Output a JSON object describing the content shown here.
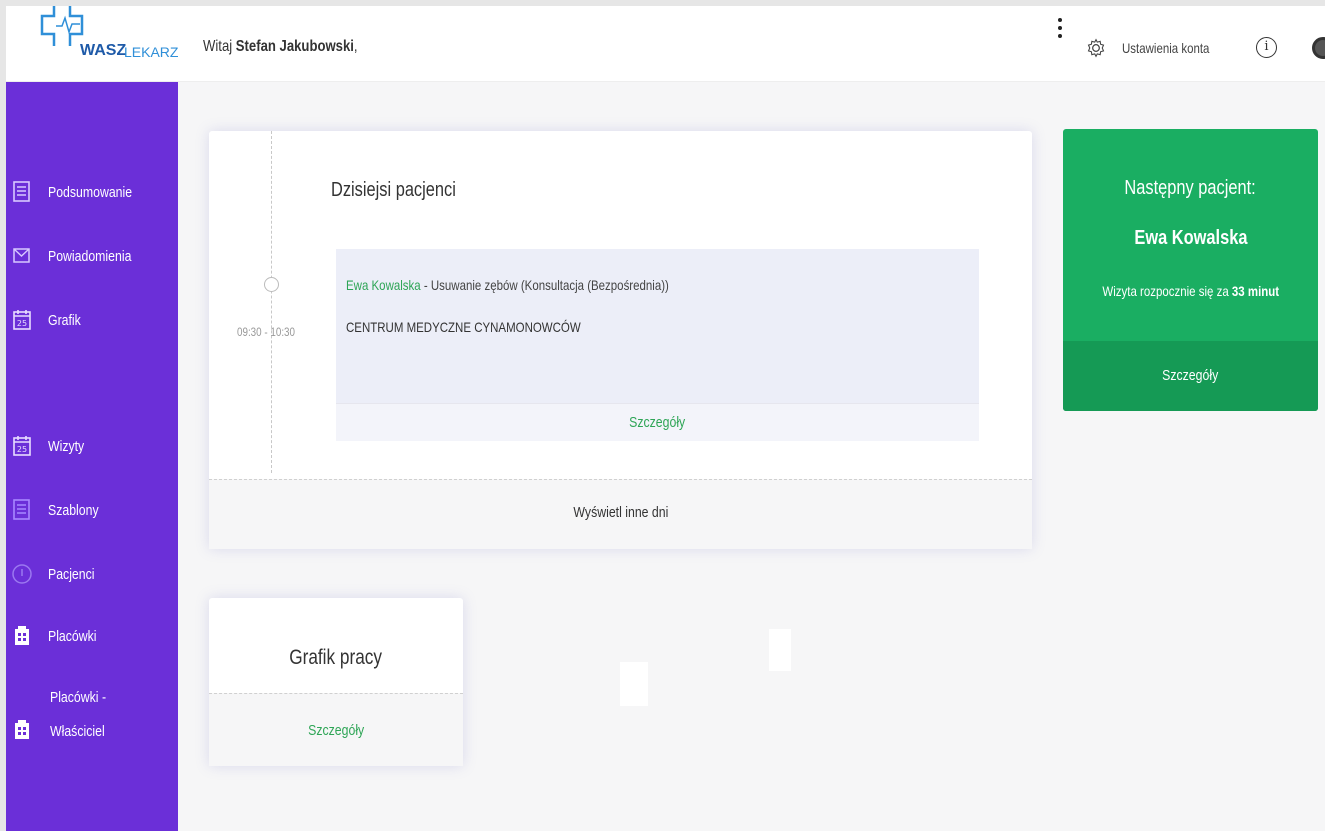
{
  "brand": {
    "wasz": "WASZ",
    "lekarz": "LEKARZ",
    "accent": "#1e5aa8"
  },
  "header": {
    "greeting": "Witaj ",
    "user_name": "Stefan Jakubowski",
    "greeting_suffix": ",",
    "settings_label": "Ustawienia konta",
    "info_symbol": "i"
  },
  "sidebar": {
    "color": "#6b2fd8",
    "items": [
      {
        "label": "Podsumowanie",
        "icon": "document-icon"
      },
      {
        "label": "Powiadomienia",
        "icon": "envelope-icon"
      },
      {
        "label": "Grafik",
        "icon": "calendar-icon"
      },
      {
        "label": "Wizyty",
        "icon": "calendar-icon"
      },
      {
        "label": "Szablony",
        "icon": "document-icon"
      },
      {
        "label": "Pacjenci",
        "icon": "user-icon"
      },
      {
        "label": "Placówki",
        "icon": "building-icon"
      },
      {
        "label": "Placówki -",
        "label2": "Właściciel",
        "icon": "building-icon"
      }
    ]
  },
  "today": {
    "title": "Dzisiejsi pacjenci",
    "time": "09:30 - 10:30",
    "patient": "Ewa Kowalska",
    "service": " - Usuwanie zębów (Konsultacja (Bezpośrednia))",
    "facility": "CENTRUM MEDYCZNE CYNAMONOWCÓW",
    "details": "Szczegóły",
    "other_days": "Wyświetl inne dni"
  },
  "next_patient": {
    "heading": "Następny pacjent:",
    "name": "Ewa Kowalska",
    "starts_prefix": "Wizyta rozpocznie się za ",
    "starts_value": "33 minut",
    "details": "Szczegóły",
    "color": "#1aae62"
  },
  "schedule": {
    "title": "Grafik pracy",
    "details": "Szczegóły"
  }
}
